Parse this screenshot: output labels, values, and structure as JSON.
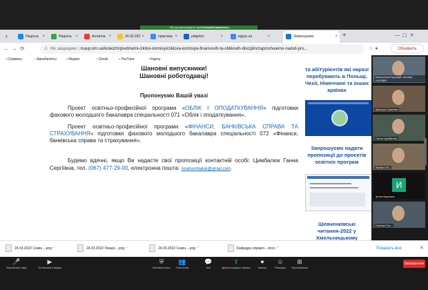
{
  "zoom_banner": {
    "text": "Вы просматриваете экран Галина Цимбалюк",
    "view_options": "Настройки просмотра"
  },
  "tabs": [
    {
      "label": "Націона",
      "color": "#1e88e5"
    },
    {
      "label": "Націона",
      "color": "#43a047"
    },
    {
      "label": "Антипла",
      "color": "#e53935"
    },
    {
      "label": "24.03.202",
      "color": "#fbc02d"
    },
    {
      "label": "практика",
      "color": "#4285f4"
    },
    {
      "label": "pidgotov",
      "color": "#1565c0"
    },
    {
      "label": "відгук на",
      "color": "#4285f4"
    },
    {
      "label": "Запрошуємо",
      "color": "#1976d2"
    }
  ],
  "address": {
    "security": "Не защищено",
    "url": "maup.km.ua/koledzh/predmetni-ciklovi-komisiyi/ciklova-komisiya-finansovih-ta-oblikovih-disciplin/zaproshuiemo-nadati-pro..."
  },
  "update_button": "Обновить",
  "bookmarks": [
    "Сервисы",
    "Авиабилеты",
    "Яндекс",
    "Gmail",
    "YouTube",
    "Карты"
  ],
  "doc": {
    "heading1": "Шановні випускники!",
    "heading2": "Шановні роботодавці!",
    "offer": "Пропонуємо Вашій увазі",
    "p1_a": "Проект освітньо-професійної програми «",
    "p1_link": "ОБЛІК І ОПОДАТКУВАННЯ",
    "p1_b": "» підготовки фахового молодшого бакалавра спеціальності 071 «Облік і оподаткування».",
    "p2_a": "Проект освітньо-професійної програми «",
    "p2_link": "ФІНАНСИ, БАНКІВСЬКА СПРАВА ТА СТРАХУВАННЯ",
    "p2_b": "» підготовки фахового молодшого бакалавра спеціальності 072 «Фінанси, банківська справа та страхування».",
    "p3_a": "Будемо вдячні, якщо Ви надасте свої пропозиції контактній особі: Цимбалюк Ганна Сергіївна, тел.",
    "phone": "(067) 477-29-00",
    "p3_b": ", електронна пошта:",
    "email": "Anatsumbaluk@gmail.com",
    "p3_c": "."
  },
  "sidebar": {
    "block1": "та абітурієнтів які наразі перебувають в Польщі, Чехії, Німеччині та інших країнах",
    "block2": "Запрошуємо надати пропозиції до проєктів освітніх програм",
    "block3": "Шевченківські читання-2022 у Хмельницькому"
  },
  "participants": [
    {
      "name": "Валентина Паращій, експерт НАЗЯВО",
      "color": "#5b6b7a"
    },
    {
      "name": "Дмитрук Гумeнюк",
      "color": "#6b5a4a"
    },
    {
      "name": "Ганна Цимбалюк",
      "color": "#4a5a50"
    },
    {
      "name": "Ярова О.Б.",
      "color": "#7a6a55"
    },
    {
      "name": "Ірина Мурашко",
      "color": "#111111",
      "initial": "И"
    },
    {
      "name": "Галина Сту...",
      "color": "#4d5a66"
    }
  ],
  "downloads": [
    "24.03.2022 Семін....png",
    "24.03.2022 Лекція....png",
    "24.03.2022 Семін....png",
    "Кафедра управлі....docx"
  ],
  "show_all": "Показать все",
  "zoom_toolbar": [
    {
      "label": "Выключить звук",
      "icon": "mic-icon"
    },
    {
      "label": "Остановить видео",
      "icon": "video-icon"
    },
    {
      "label": "Безопасность",
      "icon": "shield-icon"
    },
    {
      "label": "Участники",
      "icon": "participants-icon"
    },
    {
      "label": "Чат",
      "icon": "chat-icon"
    },
    {
      "label": "Демонстрация экрана",
      "icon": "share-screen-icon"
    },
    {
      "label": "Запись",
      "icon": "record-icon"
    },
    {
      "label": "Реакции",
      "icon": "reactions-icon"
    },
    {
      "label": "Приложения",
      "icon": "apps-icon"
    }
  ],
  "end_button": "Завершение",
  "colors": {
    "accent_green": "#2e7d32",
    "link_blue": "#1565c0",
    "end_red": "#e02828"
  }
}
